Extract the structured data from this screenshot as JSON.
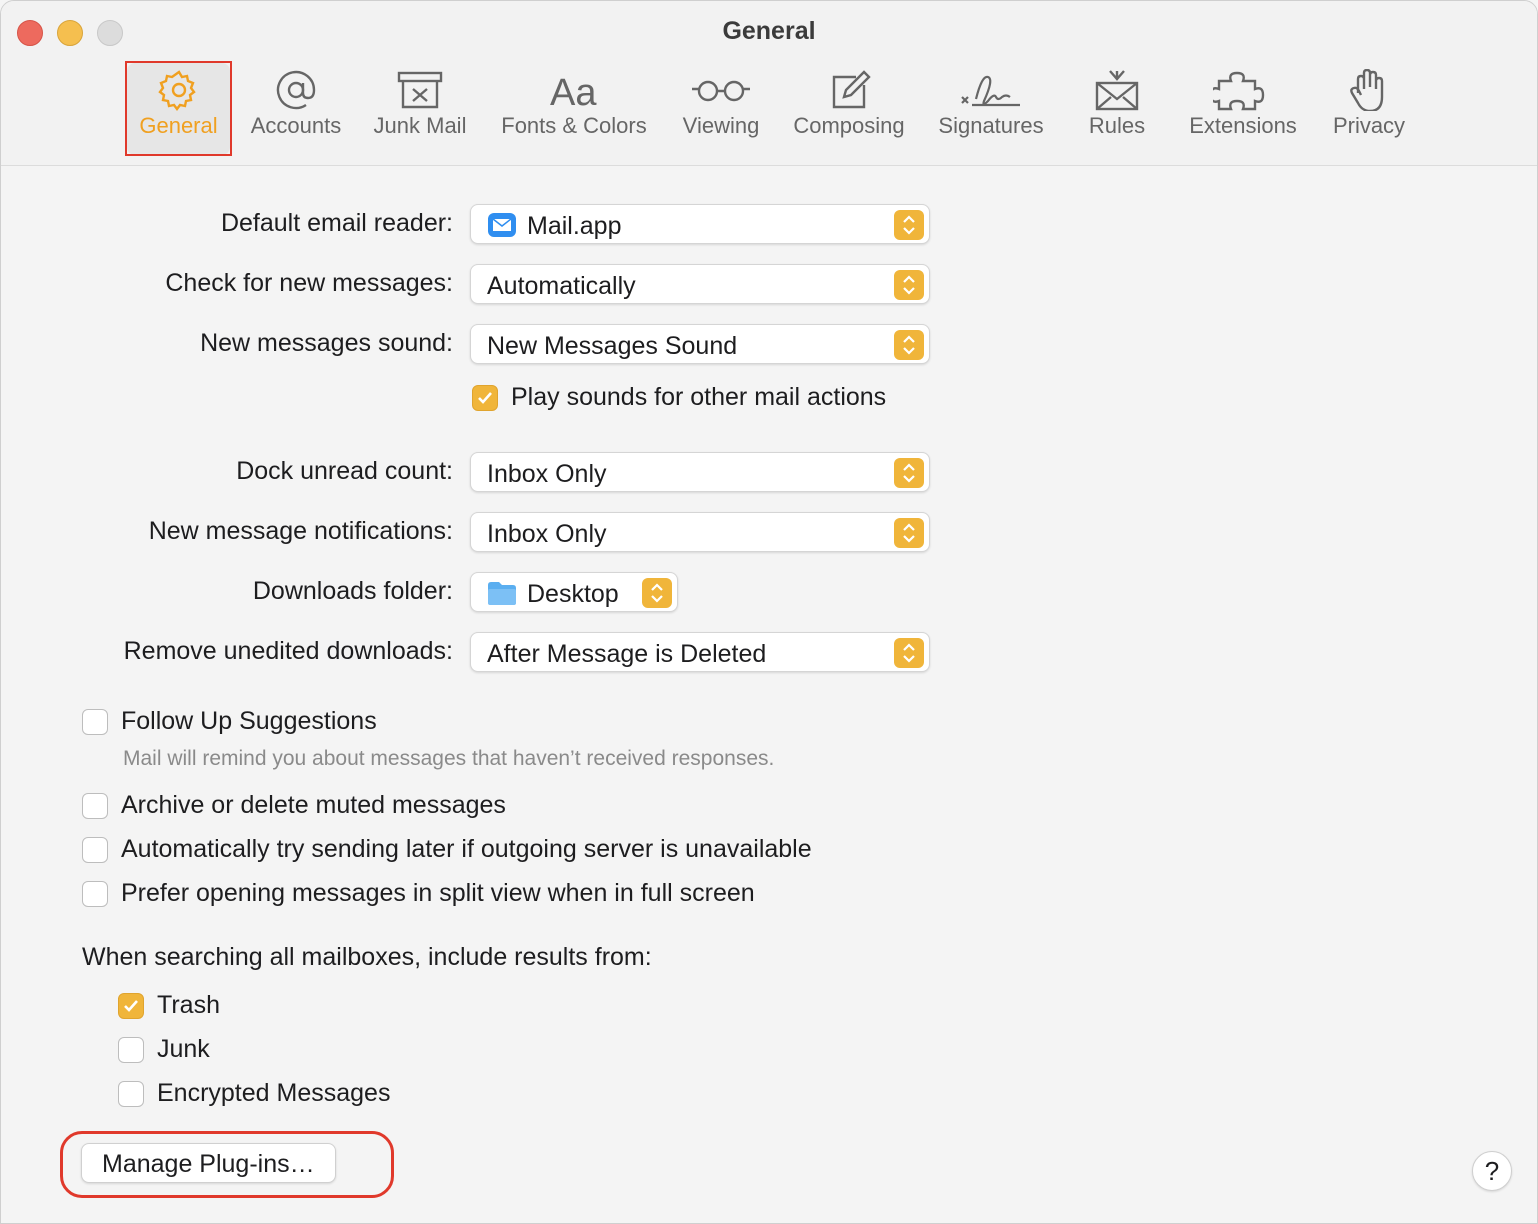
{
  "window": {
    "title": "General"
  },
  "tabs": [
    {
      "label": "General",
      "icon": "gear-icon",
      "active": true
    },
    {
      "label": "Accounts",
      "icon": "at-sign-icon"
    },
    {
      "label": "Junk Mail",
      "icon": "junk-mail-icon"
    },
    {
      "label": "Fonts & Colors",
      "icon": "fonts-icon"
    },
    {
      "label": "Viewing",
      "icon": "glasses-icon"
    },
    {
      "label": "Composing",
      "icon": "compose-icon"
    },
    {
      "label": "Signatures",
      "icon": "signature-icon"
    },
    {
      "label": "Rules",
      "icon": "rules-icon"
    },
    {
      "label": "Extensions",
      "icon": "puzzle-icon"
    },
    {
      "label": "Privacy",
      "icon": "hand-icon"
    }
  ],
  "settings": {
    "default_reader": {
      "label": "Default email reader:",
      "value": "Mail.app",
      "icon": "mail-app-icon"
    },
    "check_messages": {
      "label": "Check for new messages:",
      "value": "Automatically"
    },
    "sound": {
      "label": "New messages sound:",
      "value": "New Messages Sound"
    },
    "play_sounds": {
      "label": "Play sounds for other mail actions",
      "checked": true
    },
    "dock_count": {
      "label": "Dock unread count:",
      "value": "Inbox Only"
    },
    "notifications": {
      "label": "New message notifications:",
      "value": "Inbox Only"
    },
    "downloads": {
      "label": "Downloads folder:",
      "value": "Desktop",
      "icon": "folder-icon"
    },
    "remove_downloads": {
      "label": "Remove unedited downloads:",
      "value": "After Message is Deleted"
    }
  },
  "options": {
    "follow_up": {
      "label": "Follow Up Suggestions",
      "hint": "Mail will remind you about messages that haven’t received responses.",
      "checked": false
    },
    "archive_muted": {
      "label": "Archive or delete muted messages",
      "checked": false
    },
    "auto_retry": {
      "label": "Automatically try sending later if outgoing server is unavailable",
      "checked": false
    },
    "split_view": {
      "label": "Prefer opening messages in split view when in full screen",
      "checked": false
    }
  },
  "search": {
    "heading": "When searching all mailboxes, include results from:",
    "trash": {
      "label": "Trash",
      "checked": true
    },
    "junk": {
      "label": "Junk",
      "checked": false
    },
    "encrypted": {
      "label": "Encrypted Messages",
      "checked": false
    }
  },
  "buttons": {
    "manage_plugins": "Manage Plug-ins…",
    "help": "?"
  },
  "colors": {
    "accent": "#f0b53a",
    "highlight": "#e0392b"
  }
}
